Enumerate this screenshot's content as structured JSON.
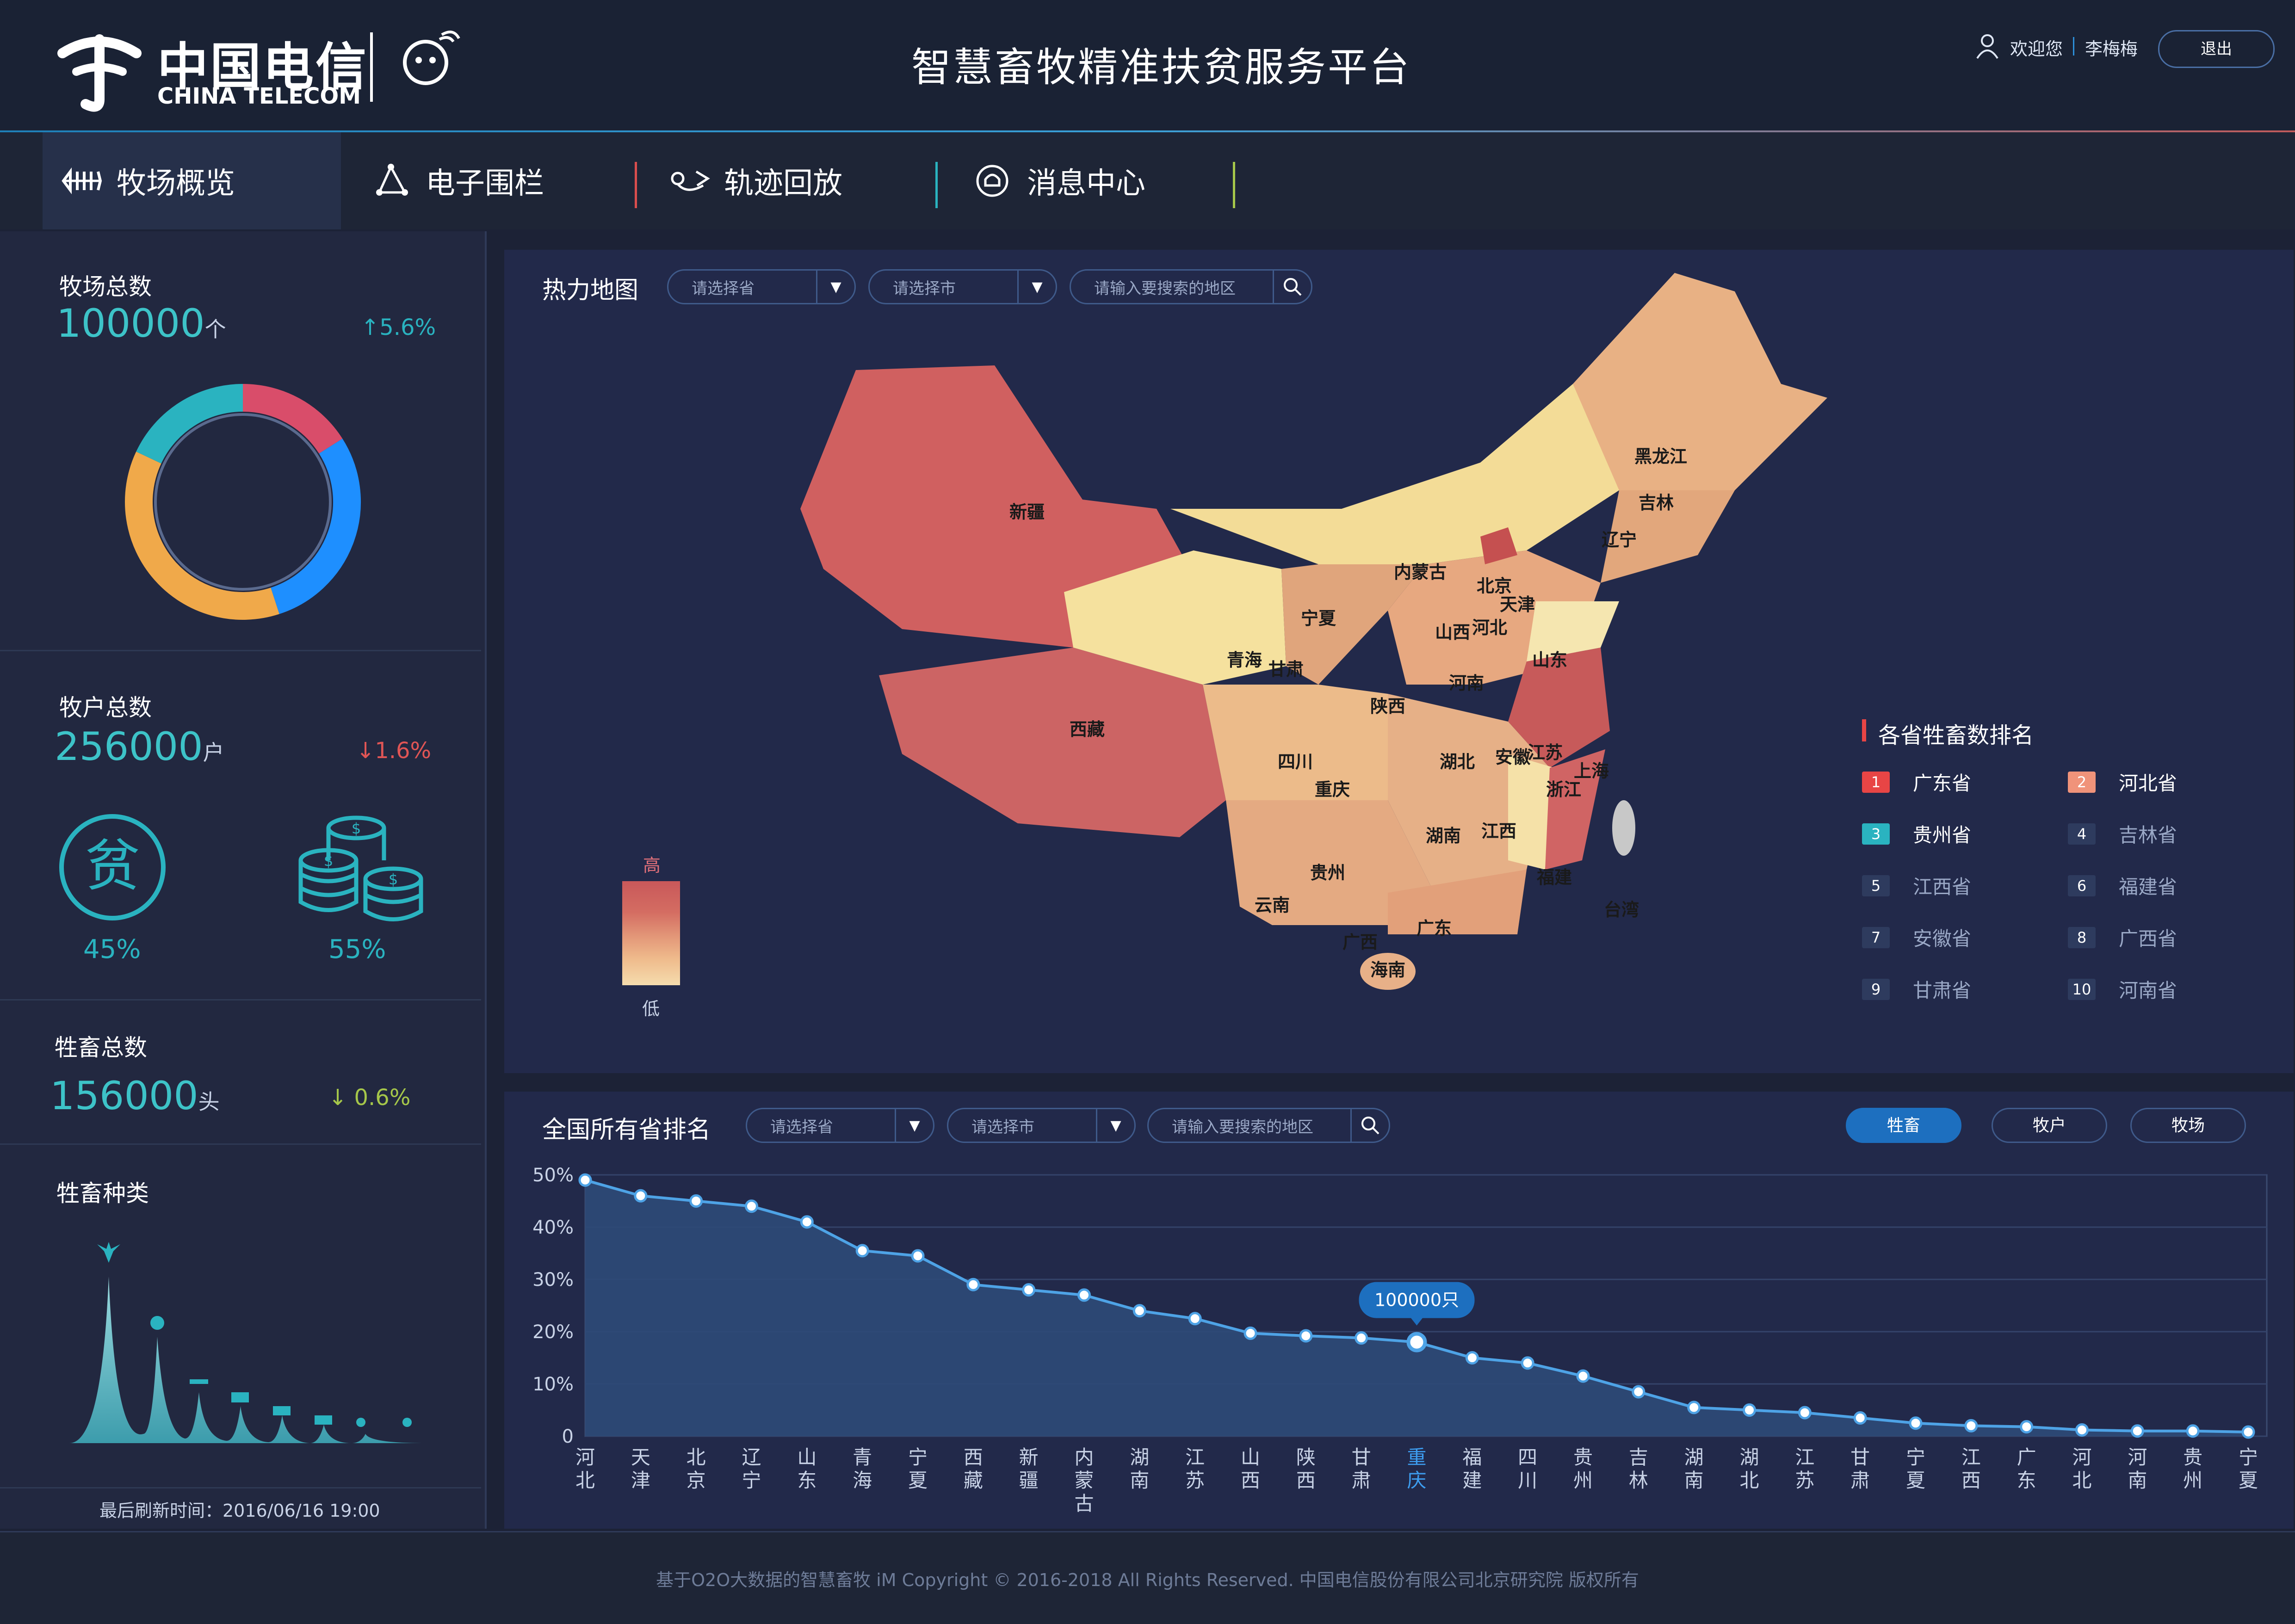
{
  "header": {
    "logo_cn": "中国电信",
    "logo_en": "CHINA TELECOM",
    "app_title": "智慧畜牧精准扶贫服务平台",
    "welcome": "欢迎您",
    "user_name": "李梅梅",
    "logout_label": "退出"
  },
  "nav": [
    {
      "label": "牧场概览",
      "icon": "ranch-icon",
      "active": true
    },
    {
      "label": "电子围栏",
      "icon": "fence-icon",
      "active": false
    },
    {
      "label": "轨迹回放",
      "icon": "track-icon",
      "active": false
    },
    {
      "label": "消息中心",
      "icon": "message-icon",
      "active": false
    }
  ],
  "left": {
    "ranch_total": {
      "label": "牧场总数",
      "value": "100000",
      "unit": "个",
      "delta": "↑5.6%"
    },
    "herder_total": {
      "label": "牧户总数",
      "value": "256000",
      "unit": "户",
      "delta": "↓1.6%"
    },
    "poverty": {
      "icon_char": "贫",
      "pct_a": "45%",
      "pct_b": "55%"
    },
    "livestock_total": {
      "label": "牲畜总数",
      "value": "156000",
      "unit": "头",
      "delta": "↓ 0.6%"
    },
    "livestock_types": {
      "label": "牲畜种类"
    },
    "last_refresh": "最后刷新时间：2016/06/16 19:00",
    "donut": [
      {
        "value": 16,
        "color": "#d94d6a"
      },
      {
        "value": 29,
        "color": "#1e8fff"
      },
      {
        "value": 37,
        "color": "#f0a94a"
      },
      {
        "value": 18,
        "color": "#2ab3c0"
      }
    ]
  },
  "map": {
    "title": "热力地图",
    "province_placeholder": "请选择省",
    "city_placeholder": "请选择市",
    "search_placeholder": "请输入要搜索的地区",
    "legend_high": "高",
    "legend_low": "低",
    "province_labels": [
      "新疆",
      "西藏",
      "青海",
      "甘肃",
      "宁夏",
      "内蒙古",
      "黑龙江",
      "吉林",
      "辽宁",
      "北京",
      "天津",
      "河北",
      "山西",
      "山东",
      "河南",
      "陕西",
      "四川",
      "重庆",
      "湖北",
      "安徽",
      "江苏",
      "上海",
      "浙江",
      "湖南",
      "江西",
      "福建",
      "台湾",
      "贵州",
      "云南",
      "广西",
      "广东",
      "海南"
    ],
    "ranking_title": "各省牲畜数排名",
    "ranking": [
      {
        "rank": "1",
        "name": "广东省",
        "color": "#e84545"
      },
      {
        "rank": "2",
        "name": "河北省",
        "color": "#f0937a"
      },
      {
        "rank": "3",
        "name": "贵州省",
        "color": "#2ab3c0"
      },
      {
        "rank": "4",
        "name": "吉林省",
        "color": "#2e3b5e"
      },
      {
        "rank": "5",
        "name": "江西省",
        "color": "#2e3b5e"
      },
      {
        "rank": "6",
        "name": "福建省",
        "color": "#2e3b5e"
      },
      {
        "rank": "7",
        "name": "安徽省",
        "color": "#2e3b5e"
      },
      {
        "rank": "8",
        "name": "广西省",
        "color": "#2e3b5e"
      },
      {
        "rank": "9",
        "name": "甘肃省",
        "color": "#2e3b5e"
      },
      {
        "rank": "10",
        "name": "河南省",
        "color": "#2e3b5e"
      }
    ]
  },
  "rank_panel": {
    "title": "全国所有省排名",
    "province_placeholder": "请选择省",
    "city_placeholder": "请选择市",
    "search_placeholder": "请输入要搜索的地区",
    "toggles": [
      {
        "label": "牲畜",
        "on": true
      },
      {
        "label": "牧户",
        "on": false
      },
      {
        "label": "牧场",
        "on": false
      }
    ],
    "tooltip": "100000只"
  },
  "chart_data": {
    "type": "area",
    "categories": [
      "河北",
      "天津",
      "北京",
      "辽宁",
      "山东",
      "青海",
      "宁夏",
      "西藏",
      "新疆",
      "内蒙古",
      "湖南",
      "江苏",
      "山西",
      "陕西",
      "甘肃",
      "重庆",
      "福建",
      "四川",
      "贵州",
      "吉林",
      "湖南",
      "湖北",
      "江苏",
      "甘肃",
      "宁夏",
      "江西",
      "广东",
      "河北",
      "河南",
      "贵州",
      "宁夏"
    ],
    "values": [
      49,
      46,
      45,
      44,
      41,
      35.5,
      34.5,
      29,
      28,
      27,
      24,
      22.5,
      19.7,
      19.2,
      18.8,
      18,
      15,
      14,
      11.5,
      8.5,
      5.5,
      5,
      4.5,
      3.5,
      2.5,
      2,
      1.8,
      1.2,
      1,
      1,
      0.8
    ],
    "highlight_index": 15,
    "ylim": [
      0,
      50
    ],
    "yticks": [
      "0",
      "10%",
      "20%",
      "30%",
      "40%",
      "50%"
    ],
    "grid": true,
    "color": "#4ea3e6"
  },
  "footer": "基于O2O大数据的智慧畜牧 iM Copyright © 2016-2018 All Rights Reserved. 中国电信股份有限公司北京研究院 版权所有"
}
